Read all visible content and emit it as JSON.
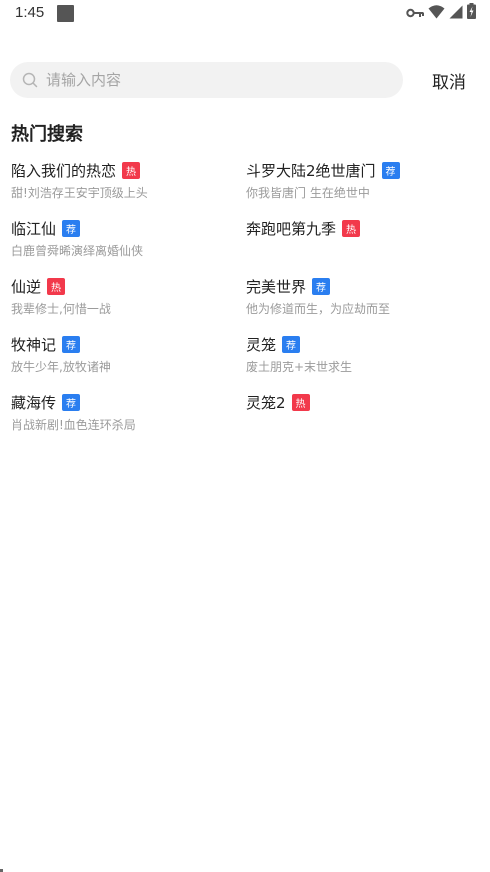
{
  "status_bar": {
    "time": "1:45",
    "icons": [
      "key-icon",
      "wifi-icon",
      "signal-icon",
      "battery-icon"
    ]
  },
  "search": {
    "placeholder": "请输入内容",
    "value": "",
    "cancel_label": "取消"
  },
  "hot_search": {
    "title": "热门搜索",
    "items": [
      {
        "title": "陷入我们的热恋",
        "tag": "热",
        "tag_type": "hot",
        "desc": "甜!刘浩存王安宇顶级上头"
      },
      {
        "title": "斗罗大陆2绝世唐门",
        "tag": "荐",
        "tag_type": "recommend",
        "desc": "你我皆唐门 生在绝世中"
      },
      {
        "title": "临江仙",
        "tag": "荐",
        "tag_type": "recommend",
        "desc": "白鹿曾舜晞演绎离婚仙侠"
      },
      {
        "title": "奔跑吧第九季",
        "tag": "热",
        "tag_type": "hot",
        "desc": ""
      },
      {
        "title": "仙逆",
        "tag": "热",
        "tag_type": "hot",
        "desc": "我辈修士,何惜一战"
      },
      {
        "title": "完美世界",
        "tag": "荐",
        "tag_type": "recommend",
        "desc": "他为修道而生，为应劫而至"
      },
      {
        "title": "牧神记",
        "tag": "荐",
        "tag_type": "recommend",
        "desc": "放牛少年,放牧诸神"
      },
      {
        "title": "灵笼",
        "tag": "荐",
        "tag_type": "recommend",
        "desc": "废土朋克+末世求生"
      },
      {
        "title": "藏海传",
        "tag": "荐",
        "tag_type": "recommend",
        "desc": "肖战新剧!血色连环杀局"
      },
      {
        "title": "灵笼2",
        "tag": "热",
        "tag_type": "hot",
        "desc": ""
      }
    ]
  },
  "colors": {
    "hot_tag": "#f2394b",
    "recommend_tag": "#2a7ef0"
  }
}
